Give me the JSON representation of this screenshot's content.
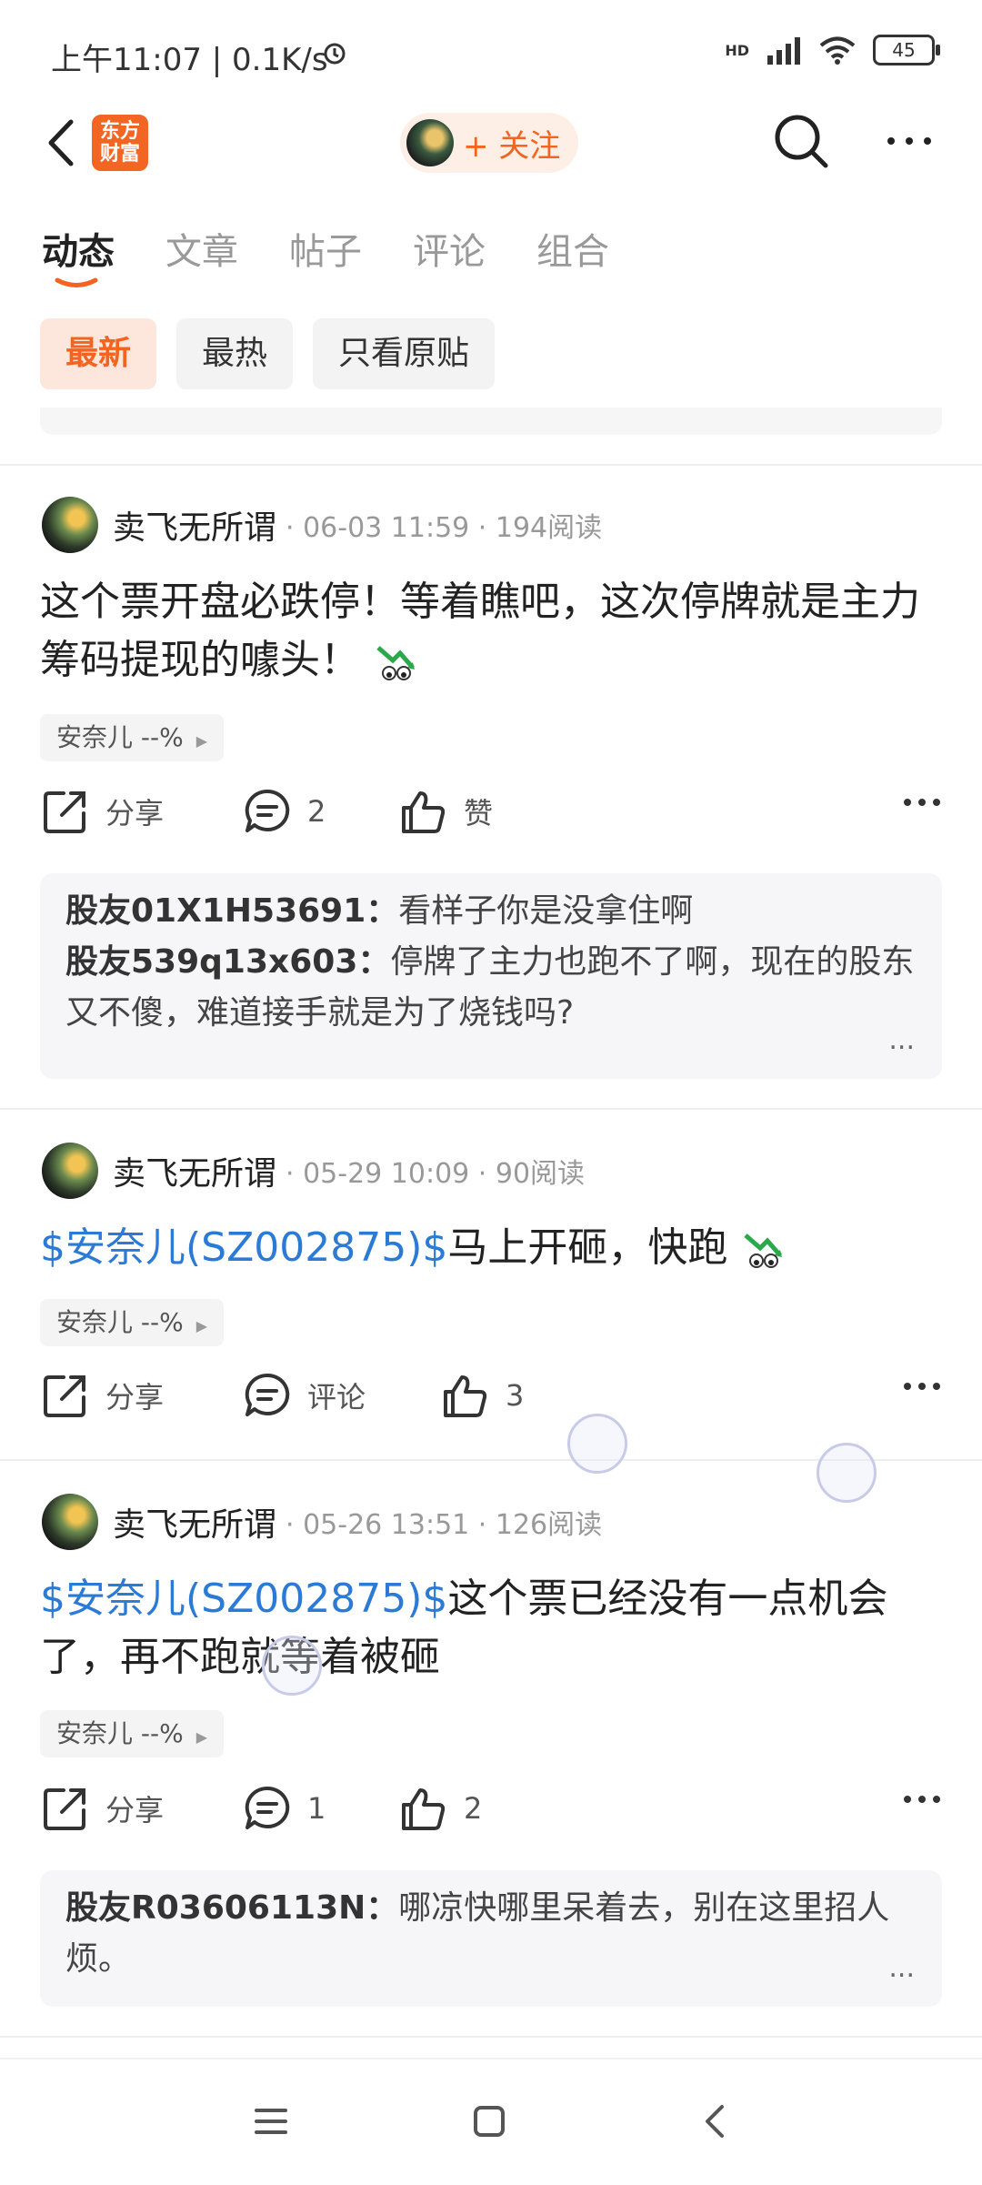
{
  "status": {
    "left": "上午11:07 | 0.1K/s",
    "battery": "45",
    "net": "HD"
  },
  "nav": {
    "logo_line1": "东方",
    "logo_line2": "财富",
    "follow": "+ 关注"
  },
  "tabs": [
    "动态",
    "文章",
    "帖子",
    "评论",
    "组合"
  ],
  "filters": [
    "最新",
    "最热",
    "只看原贴"
  ],
  "posts": [
    {
      "author": "卖飞无所谓",
      "meta": "· 06-03 11:59 · 194阅读",
      "text": "这个票开盘必跌停！等着瞧吧，这次停牌就是主力筹码提现的噱头！",
      "link": "",
      "stock": "安奈儿 --%",
      "share": "分享",
      "comment": "2",
      "like": "赞",
      "comments": [
        {
          "name": "股友01X1H53691：",
          "text": "看样子你是没拿住啊"
        },
        {
          "name": "股友539q13x603：",
          "text": "停牌了主力也跑不了啊，现在的股东又不傻，难道接手就是为了烧钱吗?"
        }
      ],
      "more": "..."
    },
    {
      "author": "卖飞无所谓",
      "meta": "· 05-29 10:09 · 90阅读",
      "link": "$安奈儿(SZ002875)$",
      "text": "马上开砸，快跑",
      "stock": "安奈儿 --%",
      "share": "分享",
      "comment": "评论",
      "like": "3"
    },
    {
      "author": "卖飞无所谓",
      "meta": "· 05-26 13:51 · 126阅读",
      "link": "$安奈儿(SZ002875)$",
      "text": "这个票已经没有一点机会了，再不跑就等着被砸",
      "stock": "安奈儿 --%",
      "share": "分享",
      "comment": "1",
      "like": "2",
      "comments": [
        {
          "name": "股友R03606113N：",
          "text": "哪凉快哪里呆着去，别在这里招人烦。"
        }
      ],
      "more": "..."
    }
  ],
  "colors": {
    "accent": "#f2641f",
    "link": "#2a7ad6"
  }
}
